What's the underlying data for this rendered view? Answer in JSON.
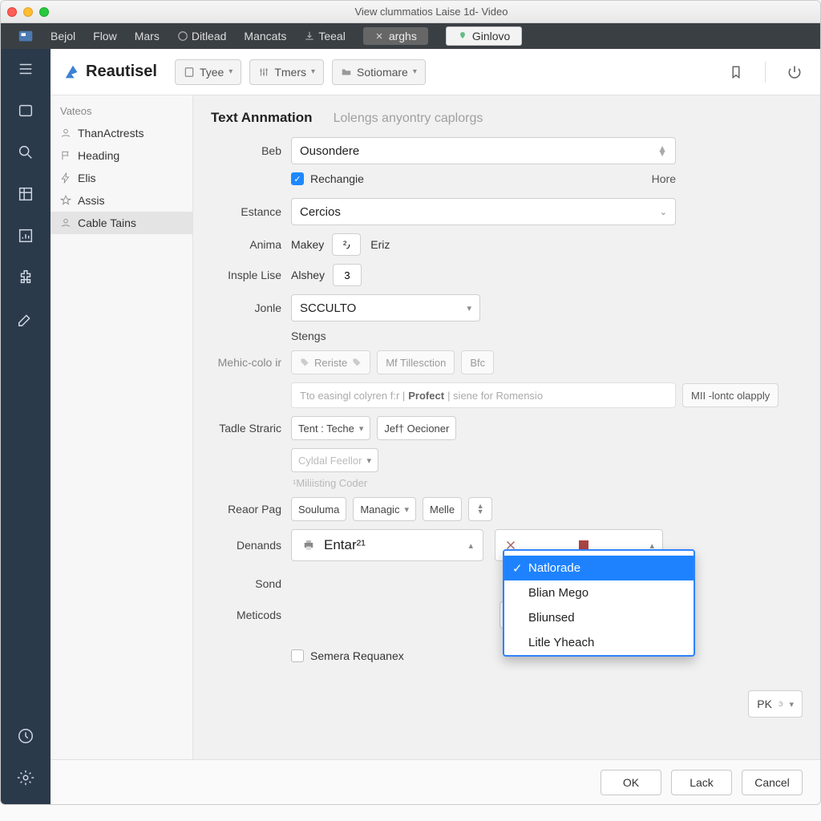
{
  "window": {
    "title": "View clummatios Laise 1d- Video"
  },
  "menubar": {
    "items": [
      "Bejol",
      "Flow",
      "Mars",
      "Ditlead",
      "Mancats",
      "Teeal"
    ],
    "pill1": "arghs",
    "pill2": "Ginlovo"
  },
  "brand": "Reautisel",
  "toolbar": {
    "type_label": "Tyee",
    "tmers_label": "Tmers",
    "sotiomare_label": "Sotiomare"
  },
  "sidebar": {
    "head": "Vateos",
    "items": [
      {
        "label": "ThanActrests"
      },
      {
        "label": "Heading"
      },
      {
        "label": "Elis"
      },
      {
        "label": "Assis"
      },
      {
        "label": "Cable Tains"
      }
    ]
  },
  "tabs": {
    "active": "Text Annmation",
    "inactive": "Lolengs anyontry caplorgs"
  },
  "form": {
    "beb": {
      "label": "Beb",
      "value": "Ousondere"
    },
    "rechangie": {
      "checkbox_label": "Rechangie",
      "right_label": "Hore"
    },
    "estance": {
      "label": "Estance",
      "value": "Cercios"
    },
    "anima": {
      "label": "Anima",
      "value": "Makey",
      "num": "²٫",
      "after": "Eriz"
    },
    "insple": {
      "label": "Insple Lise",
      "value": "Alshey",
      "num": "3"
    },
    "jonle": {
      "label": "Jonle",
      "value": "SCCULTO"
    },
    "stengs": "Stengs",
    "mehic": {
      "label": "Mehic-colo ir",
      "btn1": "Reriste",
      "btn2": "Mf  Tillesction",
      "btn3": "Bfc"
    },
    "hint": {
      "pre": "Tto easingl colyren f:r  |",
      "bold": "Profect",
      "mid": "| siene for Romensio",
      "badge": "MII -lontc olapply"
    },
    "tadle": {
      "label": "Tadle Straric",
      "sel1": "Tent : Teche",
      "btn": "Jef† Oecioner",
      "sel2": "Cyldal Feellor",
      "note": "¹Miliisting Coder"
    },
    "reaor": {
      "label": "Reaor Pag",
      "v1": "Souluma",
      "v2": "Managic",
      "v3": "Melle"
    },
    "denands": {
      "label": "Denands",
      "value": "Entar²¹"
    },
    "sond": {
      "label": "Sond"
    },
    "meticods": {
      "label": "Meticods"
    },
    "final_chk": "Semera Requanex",
    "pk": "PK"
  },
  "dropdown": {
    "options": [
      "Natlorade",
      "Blian Mego",
      "Bliunsed",
      "Litle Yheach"
    ]
  },
  "footer": {
    "ok": "OK",
    "lack": "Lack",
    "cancel": "Cancel"
  }
}
